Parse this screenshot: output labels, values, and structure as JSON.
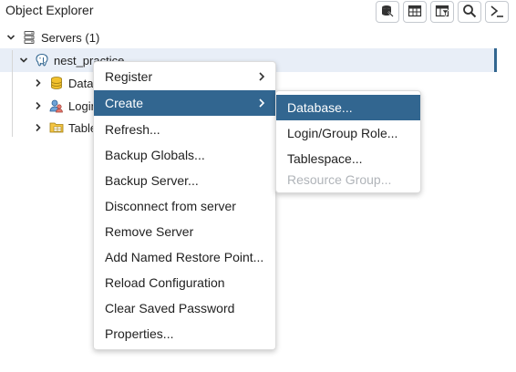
{
  "header": {
    "title": "Object Explorer",
    "toolbar": [
      {
        "icon": "query-tool-icon"
      },
      {
        "icon": "view-data-icon"
      },
      {
        "icon": "filtered-rows-icon"
      },
      {
        "icon": "search-icon"
      },
      {
        "icon": "psql-tool-icon"
      }
    ]
  },
  "tree": {
    "servers_label": "Servers (1)",
    "server_label": "nest_practice",
    "children": [
      {
        "label": "Databases",
        "icon": "databases-icon"
      },
      {
        "label": "Login/Group Roles",
        "icon": "login-roles-icon"
      },
      {
        "label": "Tablespaces",
        "icon": "tablespaces-icon"
      }
    ]
  },
  "context_menu": {
    "items": [
      {
        "label": "Register",
        "submenu": true
      },
      {
        "label": "Create",
        "submenu": true,
        "active": true
      },
      {
        "label": "Refresh..."
      },
      {
        "label": "Backup Globals..."
      },
      {
        "label": "Backup Server..."
      },
      {
        "label": "Disconnect from server"
      },
      {
        "label": "Remove Server"
      },
      {
        "label": "Add Named Restore Point..."
      },
      {
        "label": "Reload Configuration"
      },
      {
        "label": "Clear Saved Password"
      },
      {
        "label": "Properties..."
      }
    ]
  },
  "create_submenu": {
    "items": [
      {
        "label": "Database...",
        "active": true
      },
      {
        "label": "Login/Group Role..."
      },
      {
        "label": "Tablespace..."
      },
      {
        "label": "Resource Group...",
        "disabled": true
      }
    ]
  },
  "colors": {
    "accent": "#326690",
    "selected_row": "#e8eef7",
    "disabled_text": "#b0b4b9"
  }
}
